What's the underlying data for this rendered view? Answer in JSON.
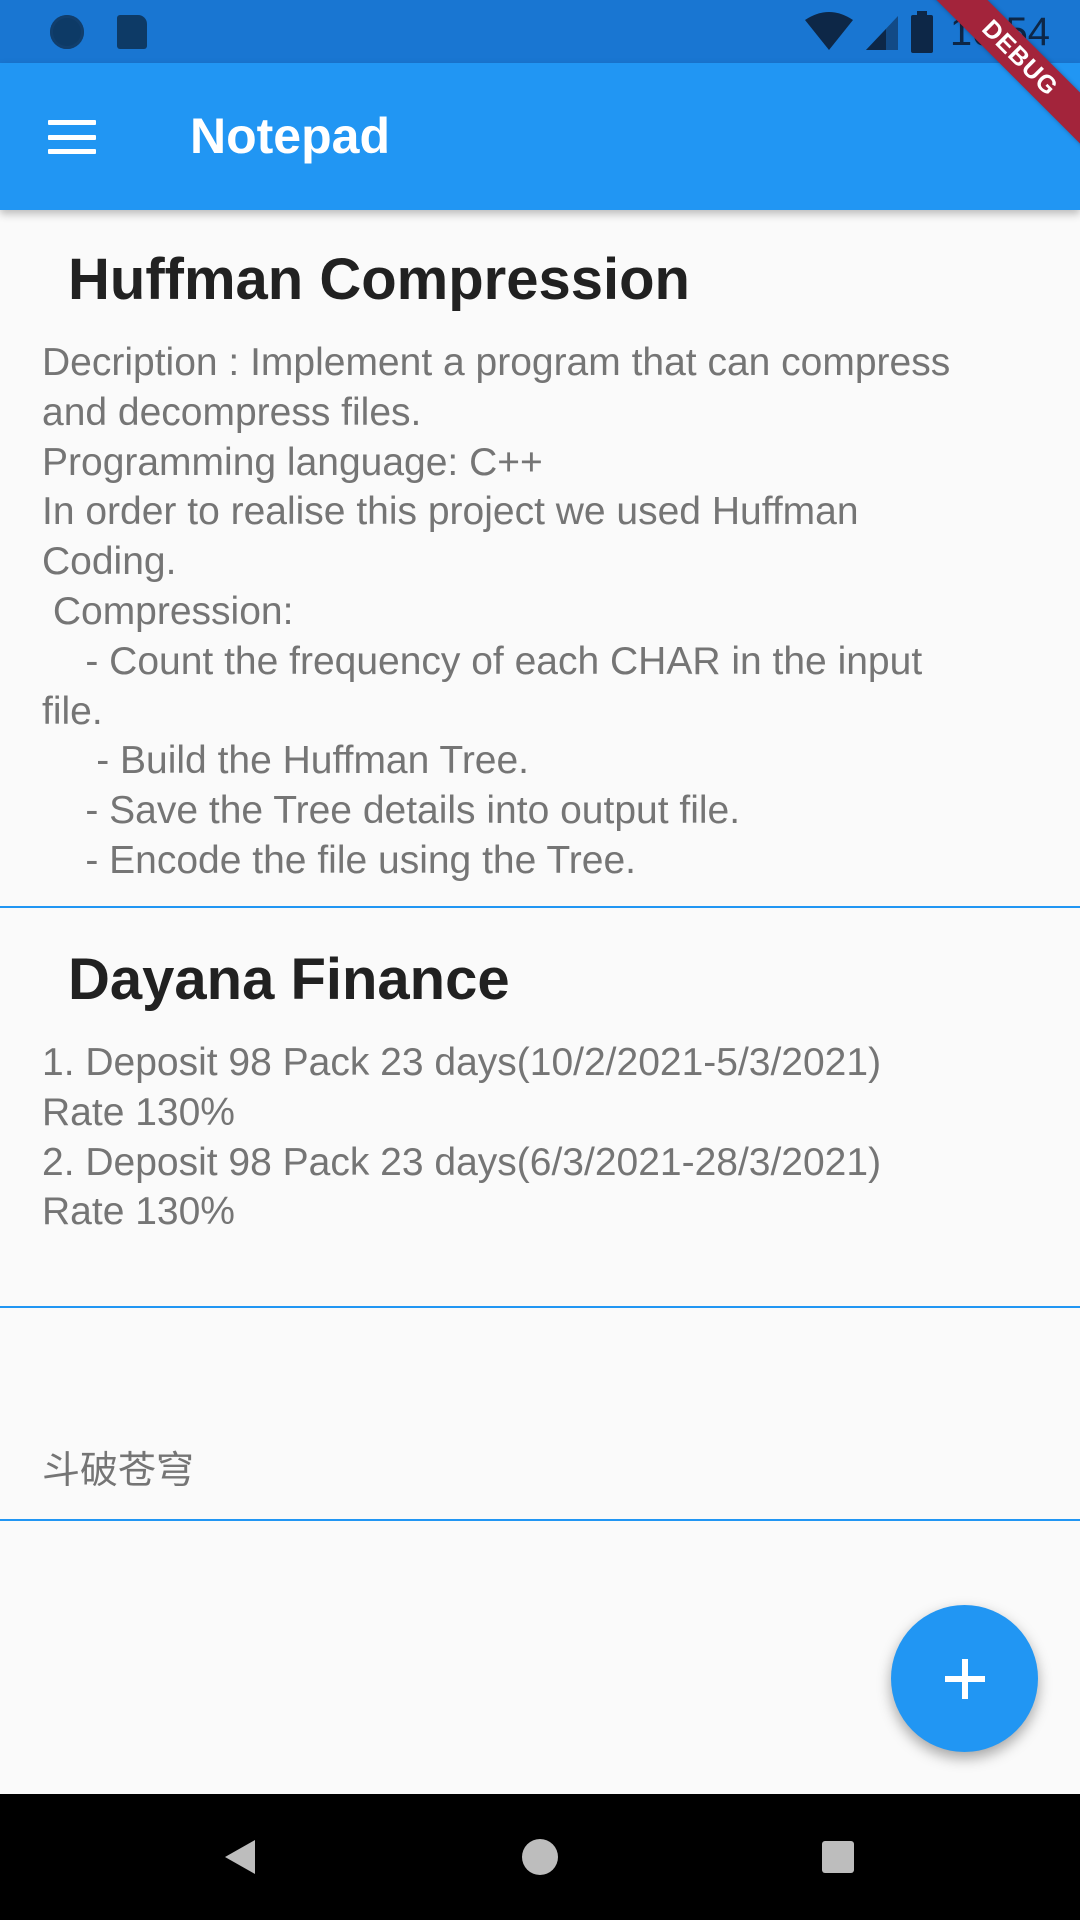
{
  "status_bar": {
    "time": "10:54",
    "icons": [
      "notification-dot-icon",
      "sd-card-icon",
      "wifi-icon",
      "signal-icon",
      "battery-icon"
    ]
  },
  "app_bar": {
    "title": "Notepad",
    "menu_icon": "menu-icon",
    "debug_label": "DEBUG"
  },
  "notes": [
    {
      "title": "Huffman Compression",
      "body": "Decription : Implement a program that can compress\nand decompress files.\nProgramming language: C++\nIn order to realise this project we used Huffman\nCoding.\n Compression:\n    - Count the frequency of each CHAR in the input\nfile.\n     - Build the Huffman Tree.\n    - Save the Tree details into output file.\n    - Encode the file using the Tree."
    },
    {
      "title": "Dayana Finance",
      "body": "1. Deposit 98 Pack 23 days(10/2/2021-5/3/2021)\nRate 130%\n2. Deposit 98 Pack 23 days(6/3/2021-28/3/2021)\nRate 130%"
    },
    {
      "title": "",
      "body": "斗破苍穹"
    }
  ],
  "fab": {
    "icon": "plus-icon"
  },
  "nav_bar": {
    "icons": [
      "back-icon",
      "home-icon",
      "recents-icon"
    ]
  },
  "colors": {
    "primary": "#2196f3",
    "status_bar": "#1976d2",
    "background": "#fafafa",
    "title_text": "#212121",
    "body_text": "#757575",
    "debug_banner": "#a3243b"
  }
}
